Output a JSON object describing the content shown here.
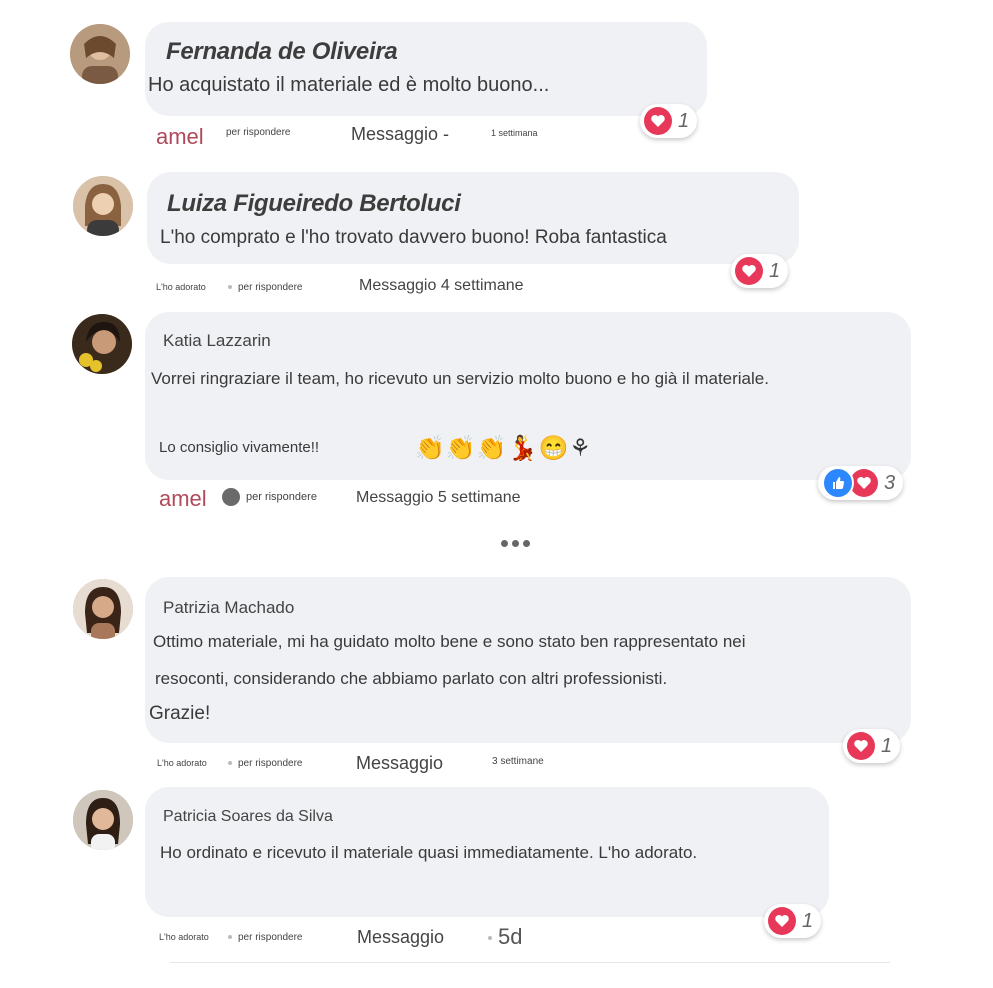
{
  "comments": [
    {
      "name": "Fernanda de Oliveira",
      "text": "Ho acquistato il materiale ed è molto buono...",
      "actions": {
        "like": "amel",
        "reply": "per rispondere",
        "message": "Messaggio -",
        "time": "1 settimana"
      },
      "reaction_count": "1"
    },
    {
      "name": "Luiza Figueiredo Bertoluci",
      "text": "L'ho comprato e l'ho trovato davvero buono! Roba fantastica",
      "actions": {
        "like": "L'ho adorato",
        "reply": "per rispondere",
        "message_time": "Messaggio 4 settimane"
      },
      "reaction_count": "1"
    },
    {
      "name": "Katia Lazzarin",
      "text_line1": "Vorrei ringraziare il team, ho ricevuto un servizio molto buono e ho già il materiale.",
      "text_line2": "Lo consiglio vivamente!!",
      "emojis": "👏👏👏💃😁⚘",
      "actions": {
        "like": "amel",
        "reply": "per rispondere",
        "message_time": "Messaggio 5 settimane"
      },
      "reaction_count": "3"
    },
    {
      "name": "Patrizia Machado",
      "text_line1": "Ottimo materiale, mi ha guidato molto bene e sono stato ben rappresentato nei",
      "text_line2": "resoconti, considerando che abbiamo parlato con altri professionisti.",
      "text_line3": "Grazie!",
      "actions": {
        "like": "L'ho adorato",
        "reply": "per rispondere",
        "message": "Messaggio",
        "time": "3 settimane"
      },
      "reaction_count": "1"
    },
    {
      "name": "Patricia Soares da Silva",
      "text": "Ho ordinato e ricevuto il materiale quasi immediatamente. L'ho adorato.",
      "actions": {
        "like": "L'ho adorato",
        "reply": "per rispondere",
        "message": "Messaggio",
        "time": "5d"
      },
      "reaction_count": "1"
    }
  ],
  "colors": {
    "bubble": "#f0f1f4",
    "heart": "#e8385a",
    "like": "#2d88ff",
    "brand": "#b04a5a"
  },
  "icons": [
    "heart-icon",
    "like-icon",
    "more-icon"
  ]
}
